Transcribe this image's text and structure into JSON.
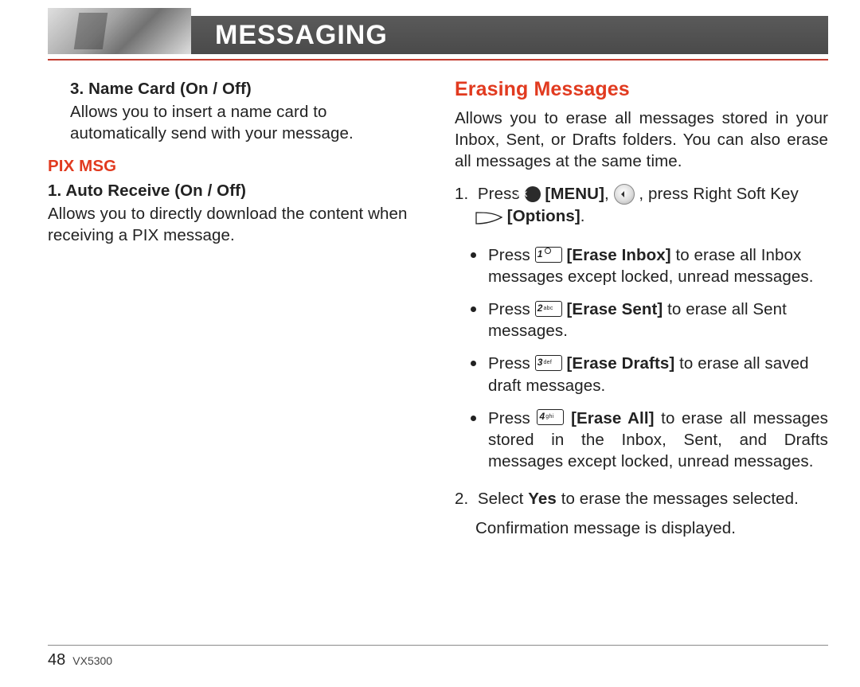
{
  "header": {
    "title": "MESSAGING"
  },
  "left": {
    "nameCard": {
      "heading": "3. Name Card (On / Off)",
      "body": "Allows you to insert a name card to automatically send with your message."
    },
    "pixMsg": {
      "heading": "PIX MSG",
      "autoReceive": {
        "heading": "1. Auto Receive (On / Off)",
        "body": "Allows you to directly download the content when receiving a PIX message."
      }
    }
  },
  "right": {
    "erasing": {
      "heading": "Erasing Messages",
      "intro": "Allows you to erase all messages stored in your Inbox, Sent, or Drafts folders. You can also erase all messages at the same time.",
      "step1_a": "Press ",
      "step1_menu": "[MENU]",
      "step1_b": ", ",
      "step1_c": " , press Right Soft Key ",
      "step1_options": "[Options]",
      "step1_d": ".",
      "bullets": {
        "b1_a": "Press ",
        "b1_label": "[Erase Inbox]",
        "b1_b": " to erase all Inbox messages except locked, unread messages.",
        "b2_a": "Press ",
        "b2_label": "[Erase Sent]",
        "b2_b": " to erase all Sent messages.",
        "b3_a": "Press ",
        "b3_label": "[Erase Drafts]",
        "b3_b": " to erase all saved draft messages.",
        "b4_a": "Press ",
        "b4_label": "[Erase All]",
        "b4_b": " to erase all messages stored in the Inbox, Sent, and Drafts messages except locked, unread messages."
      },
      "step2_a": "Select ",
      "step2_yes": "Yes",
      "step2_b": " to erase the messages selected.",
      "confirm": "Confirmation message is displayed."
    }
  },
  "keys": {
    "ok": "OK",
    "k1": {
      "num": "1",
      "sub": ""
    },
    "k2": {
      "num": "2",
      "sub": "abc"
    },
    "k3": {
      "num": "3",
      "sub": "def"
    },
    "k4": {
      "num": "4",
      "sub": "ghi"
    }
  },
  "footer": {
    "page": "48",
    "model": "VX5300"
  }
}
